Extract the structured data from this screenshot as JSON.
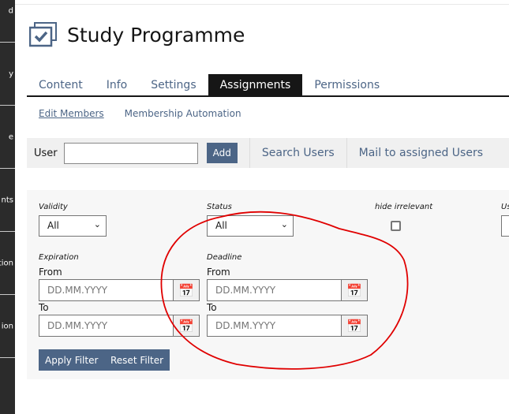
{
  "sidebar": {
    "items": [
      {
        "label": "d"
      },
      {
        "label": "y"
      },
      {
        "label": "e"
      },
      {
        "label": "nts"
      },
      {
        "label": "ation"
      },
      {
        "label": "ion"
      }
    ]
  },
  "header": {
    "title": "Study Programme",
    "icon": "checkbox-window-icon"
  },
  "tabs": [
    {
      "label": "Content"
    },
    {
      "label": "Info"
    },
    {
      "label": "Settings"
    },
    {
      "label": "Assignments",
      "active": true
    },
    {
      "label": "Permissions"
    }
  ],
  "subtabs": [
    {
      "label": "Edit Members"
    },
    {
      "label": "Membership Automation"
    }
  ],
  "toolbar": {
    "user_label": "User",
    "user_value": "",
    "add_label": "Add",
    "search_users": "Search Users",
    "mail_users": "Mail to assigned Users"
  },
  "filter": {
    "validity": {
      "label": "Validity",
      "value": "All"
    },
    "status": {
      "label": "Status",
      "value": "All"
    },
    "hide_irrelevant": {
      "label": "hide irrelevant",
      "checked": false
    },
    "cut_label": "Us",
    "expiration": {
      "label": "Expiration",
      "from": "From",
      "to": "To",
      "from_placeholder": "DD.MM.YYYY",
      "to_placeholder": "DD.MM.YYYY"
    },
    "deadline": {
      "label": "Deadline",
      "from": "From",
      "to": "To",
      "from_placeholder": "DD.MM.YYYY",
      "to_placeholder": "DD.MM.YYYY"
    },
    "apply": "Apply Filter",
    "reset": "Reset Filter"
  },
  "colors": {
    "accent": "#4c6586",
    "annotation": "#e00000"
  }
}
